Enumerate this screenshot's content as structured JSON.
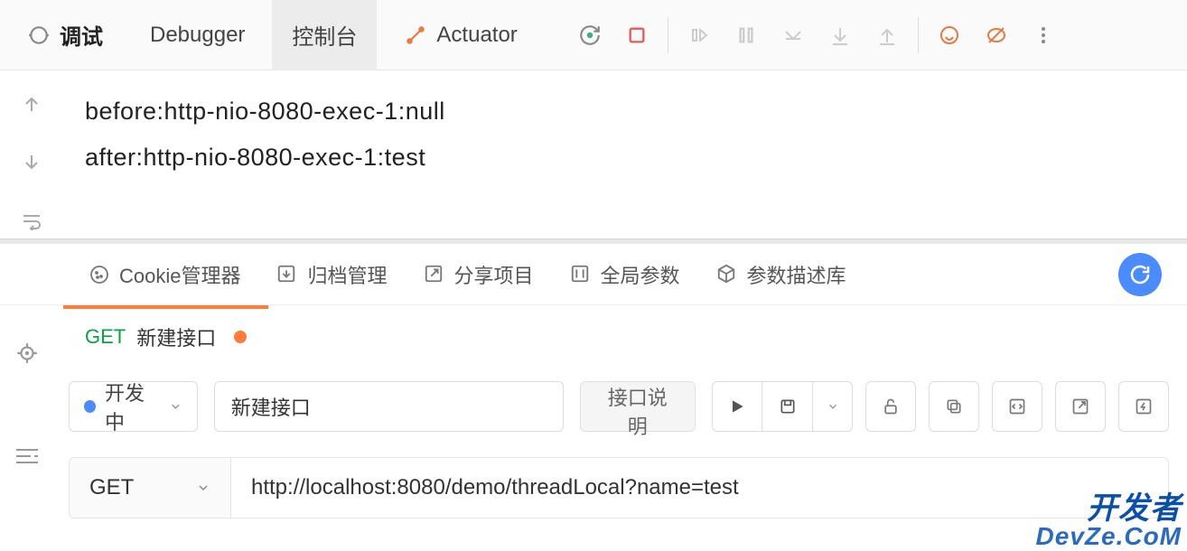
{
  "debugger": {
    "tabs": {
      "debug": "调试",
      "debugger": "Debugger",
      "console": "控制台",
      "actuator": "Actuator"
    },
    "console_lines": [
      "before:http-nio-8080-exec-1:null",
      "after:http-nio-8080-exec-1:test"
    ]
  },
  "api": {
    "toolbar": {
      "cookie_manager": "Cookie管理器",
      "archive": "归档管理",
      "share": "分享项目",
      "global_params": "全局参数",
      "param_lib": "参数描述库"
    },
    "tab": {
      "method": "GET",
      "name": "新建接口"
    },
    "form": {
      "status": "开发中",
      "name_value": "新建接口",
      "desc_btn": "接口说明"
    },
    "request": {
      "method": "GET",
      "url": "http://localhost:8080/demo/threadLocal?name=test"
    }
  },
  "watermark": {
    "line1": "开发者",
    "line2": "DevZe.CoM"
  }
}
